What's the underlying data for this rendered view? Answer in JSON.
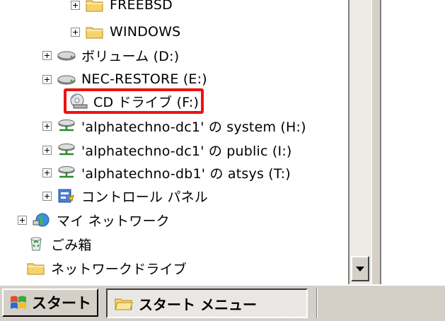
{
  "tree": {
    "items": [
      {
        "label": "FREEBSD",
        "icon": "folder-icon"
      },
      {
        "label": "WINDOWS",
        "icon": "folder-icon"
      },
      {
        "label": "ボリューム (D:)",
        "icon": "hard-drive-icon"
      },
      {
        "label": "NEC-RESTORE (E:)",
        "icon": "hard-drive-icon"
      },
      {
        "label": "CD ドライブ (F:)",
        "icon": "cd-drive-icon",
        "highlighted": true
      },
      {
        "label": "'alphatechno-dc1' の system (H:)",
        "icon": "network-drive-icon"
      },
      {
        "label": "'alphatechno-dc1' の public (I:)",
        "icon": "network-drive-icon"
      },
      {
        "label": "'alphatechno-db1' の atsys (T:)",
        "icon": "network-drive-icon"
      },
      {
        "label": "コントロール パネル",
        "icon": "control-panel-icon"
      },
      {
        "label": "マイ ネットワーク",
        "icon": "my-network-icon"
      },
      {
        "label": "ごみ箱",
        "icon": "recycle-bin-icon"
      },
      {
        "label": "ネットワークドライブ",
        "icon": "folder-icon"
      }
    ]
  },
  "taskbar": {
    "start_label": "スタート",
    "task_label": "スタート メニュー"
  },
  "colors": {
    "highlight": "#ee1111",
    "taskbar": "#d4d0c8"
  }
}
